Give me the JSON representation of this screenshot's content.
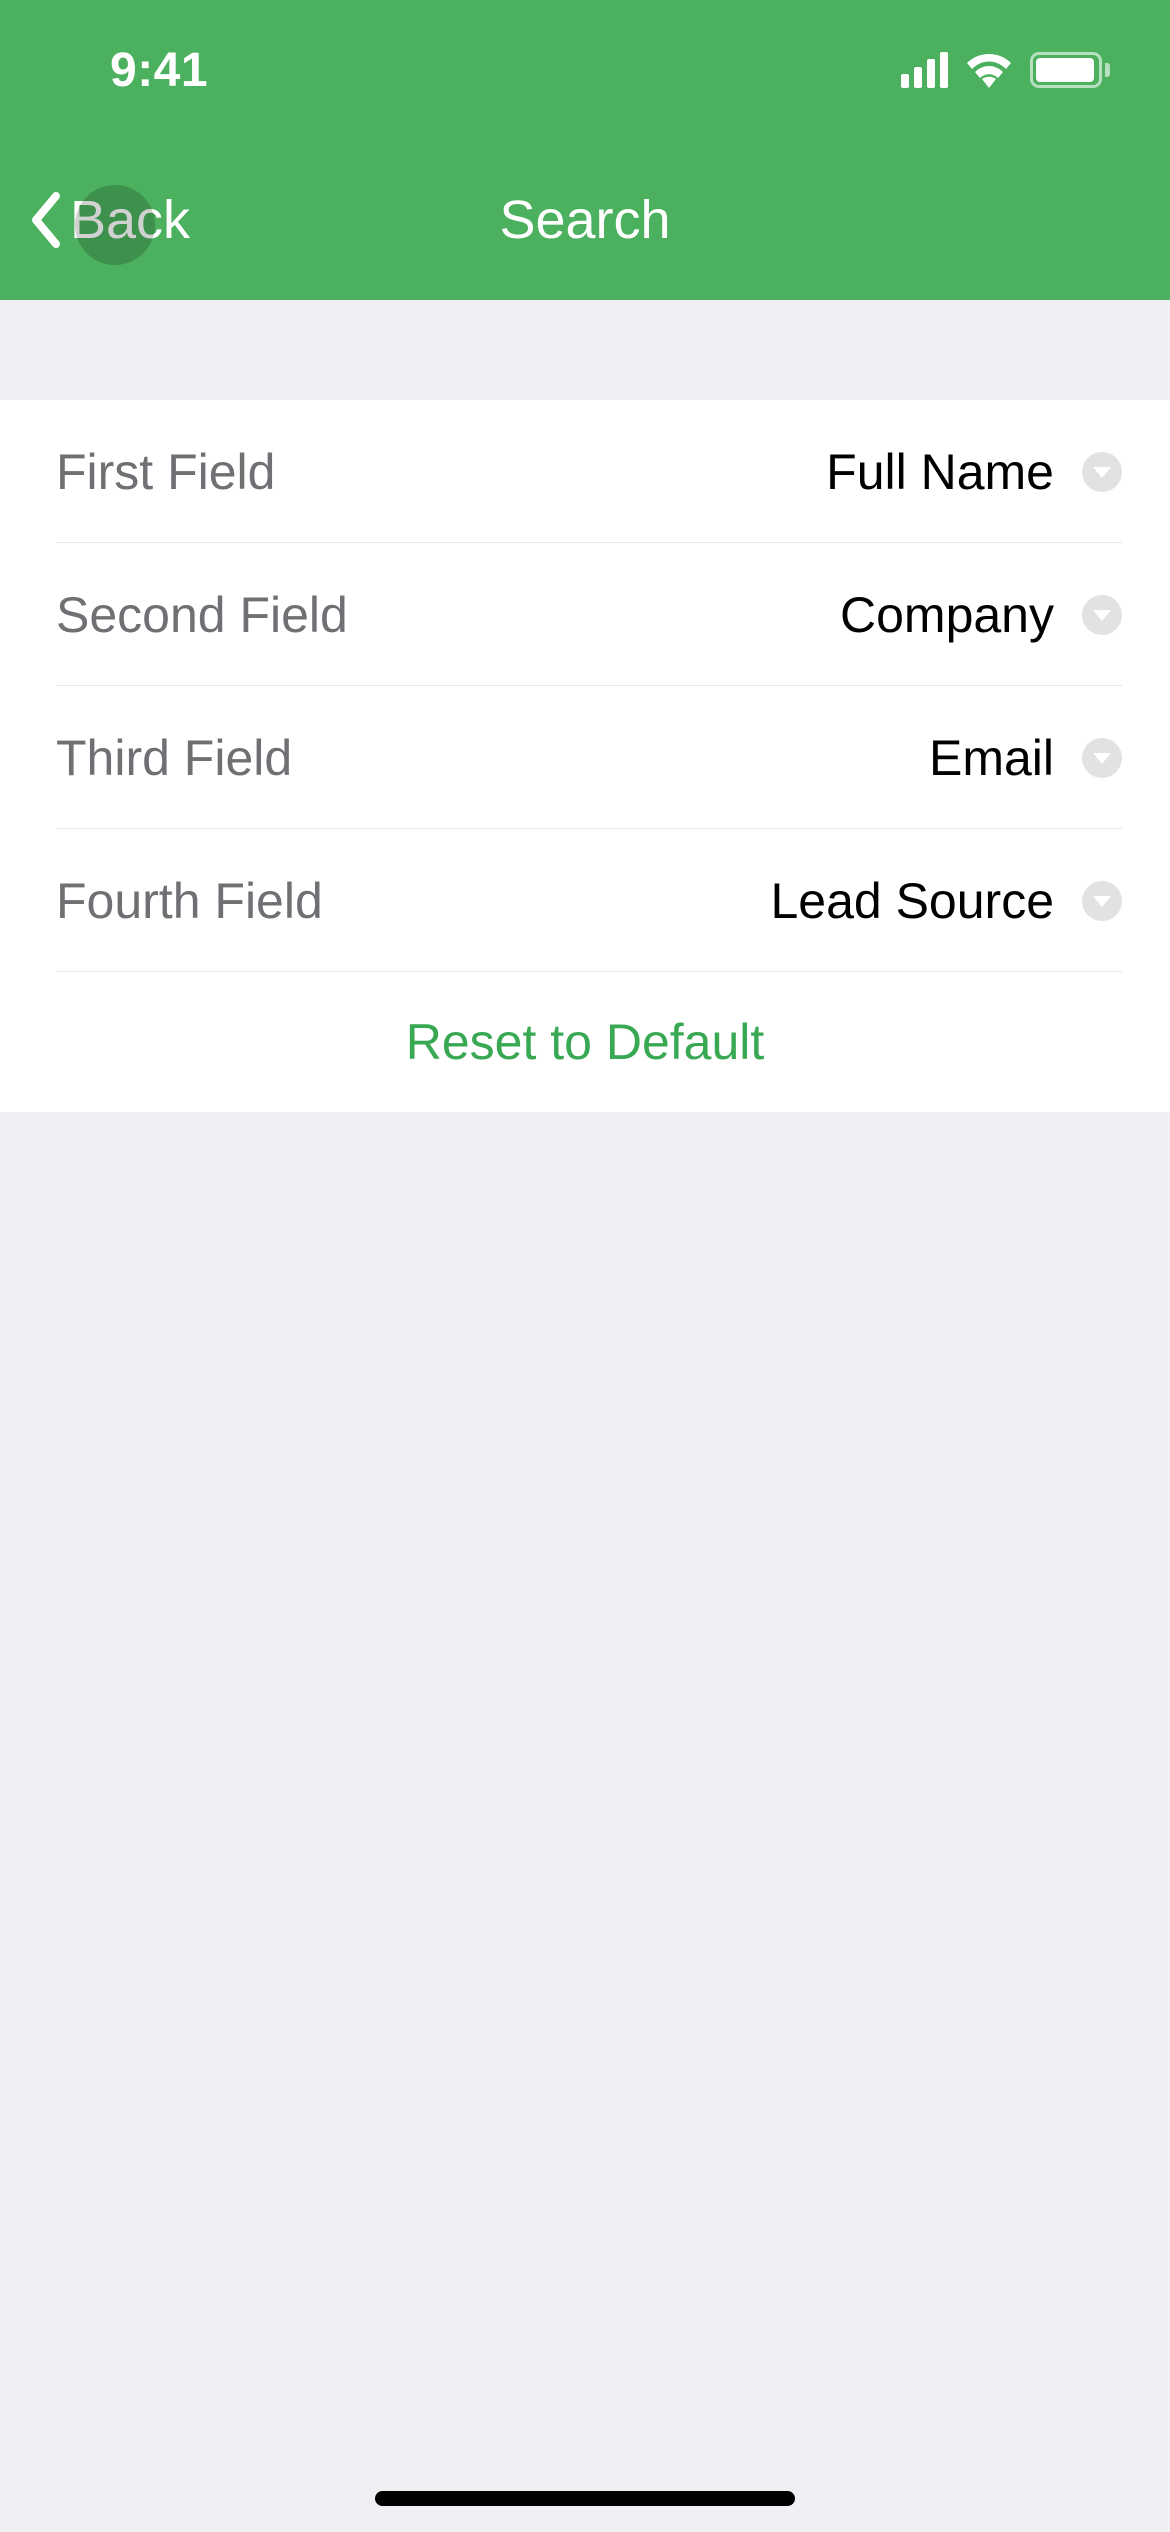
{
  "status": {
    "time": "9:41"
  },
  "nav": {
    "back_label": "Back",
    "title": "Search"
  },
  "fields": [
    {
      "label": "First Field",
      "value": "Full Name"
    },
    {
      "label": "Second Field",
      "value": "Company"
    },
    {
      "label": "Third Field",
      "value": "Email"
    },
    {
      "label": "Fourth Field",
      "value": "Lead Source"
    }
  ],
  "reset": {
    "label": "Reset to Default"
  },
  "colors": {
    "accent": "#4bb15f",
    "action_text": "#38a853"
  }
}
